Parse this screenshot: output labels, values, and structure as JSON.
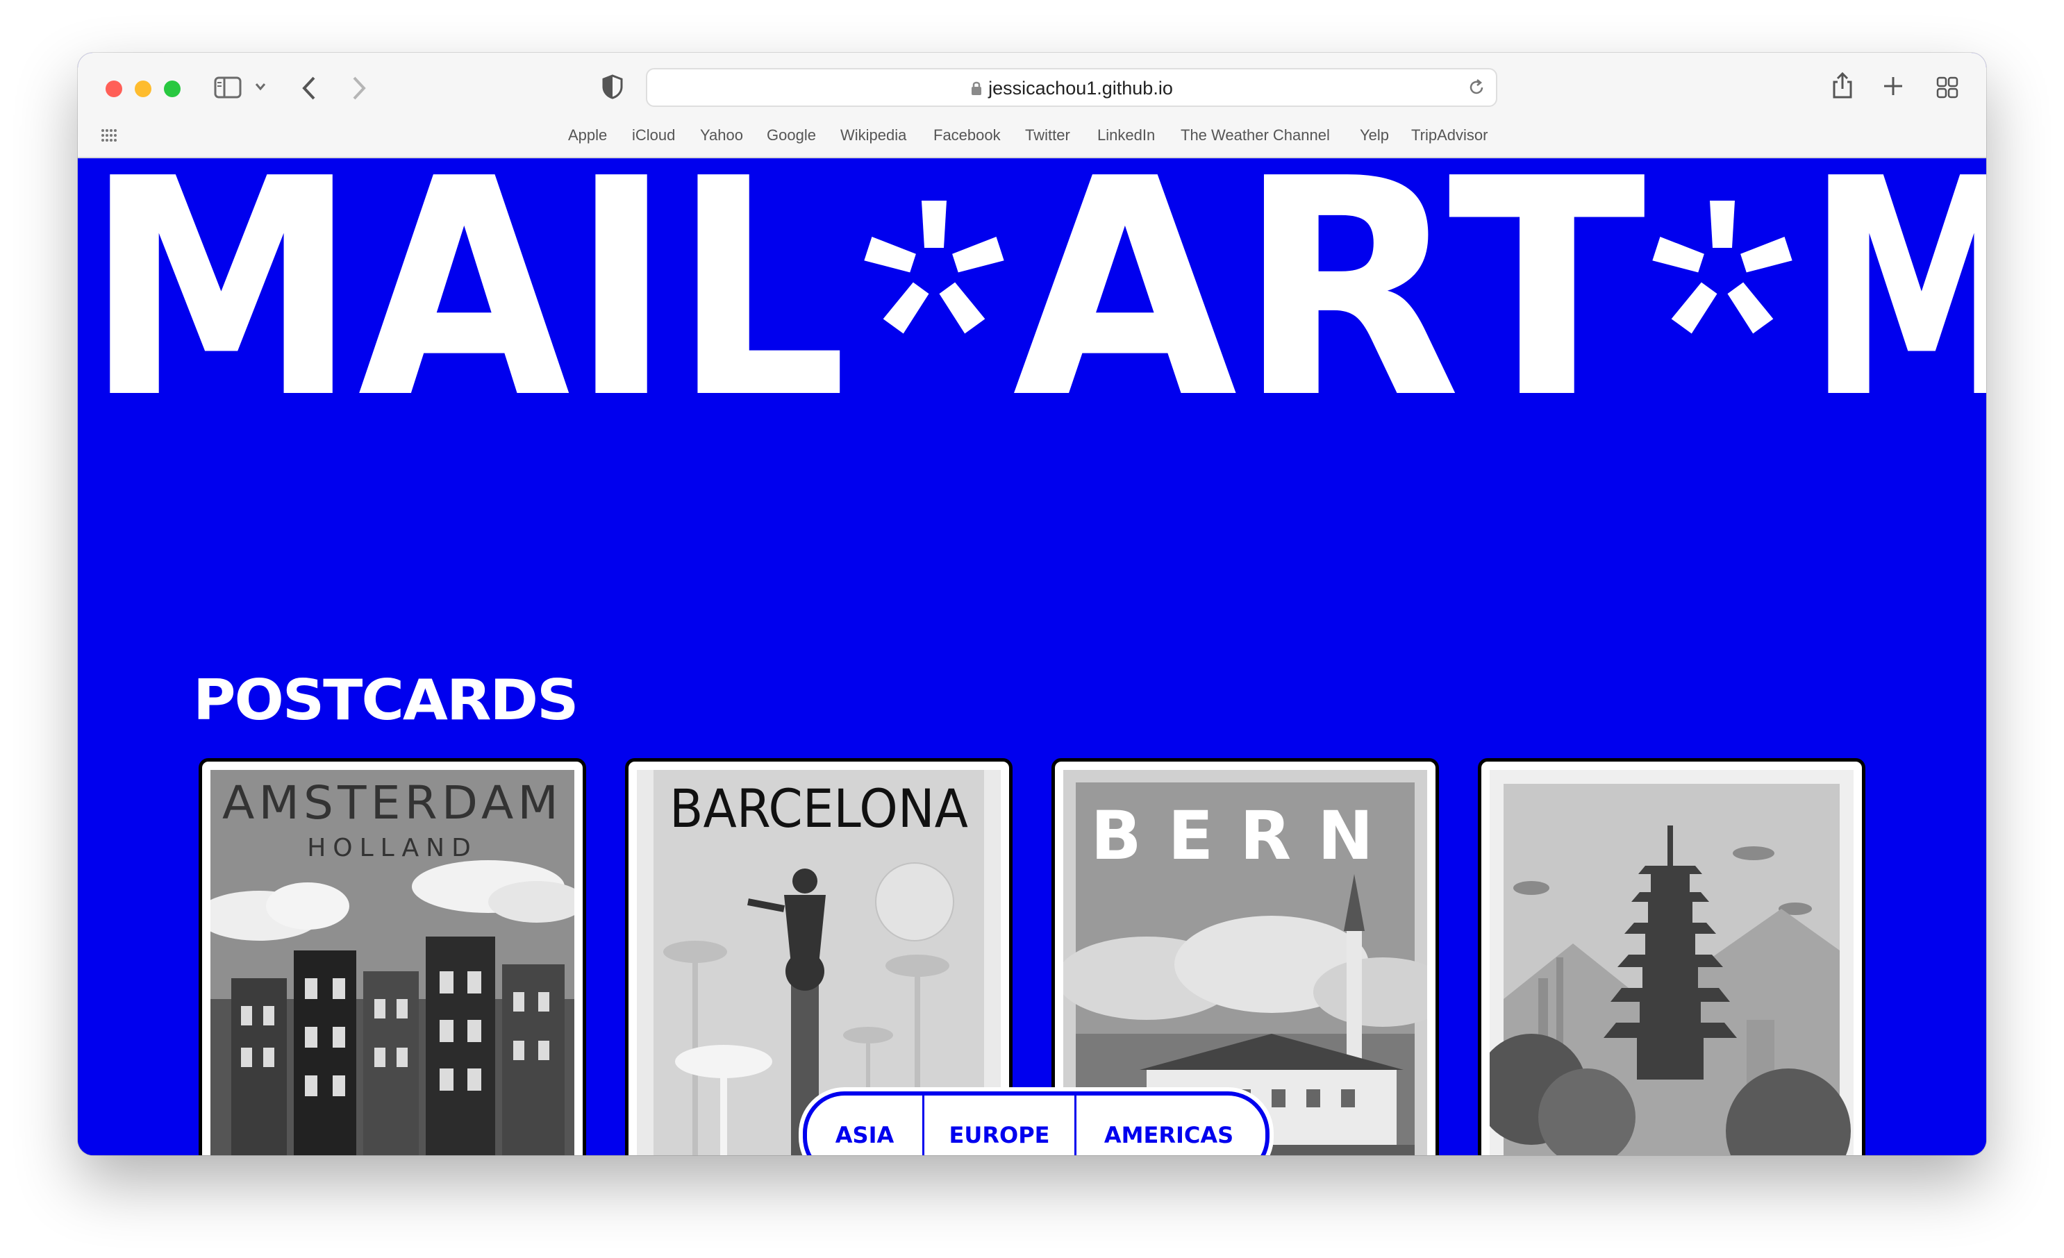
{
  "browser": {
    "url": "jessicachou1.github.io",
    "bookmarks": [
      "Apple",
      "iCloud",
      "Yahoo",
      "Google",
      "Wikipedia",
      "Facebook",
      "Twitter",
      "LinkedIn",
      "The Weather Channel",
      "Yelp",
      "TripAdvisor"
    ]
  },
  "hero": {
    "marquee_words": [
      "MAIL",
      "ART",
      "M"
    ]
  },
  "section": {
    "title": "POSTCARDS"
  },
  "cards": [
    {
      "title": "AMSTERDAM",
      "subtitle": "HOLLAND"
    },
    {
      "title": "BARCELONA",
      "subtitle": ""
    },
    {
      "title": "BERN",
      "subtitle": ""
    },
    {
      "title": "",
      "subtitle": ""
    }
  ],
  "filters": [
    "ASIA",
    "EUROPE",
    "AMERICAS"
  ],
  "colors": {
    "accent": "#0000ee",
    "text_on_accent": "#ffffff",
    "card_border": "#000000"
  }
}
